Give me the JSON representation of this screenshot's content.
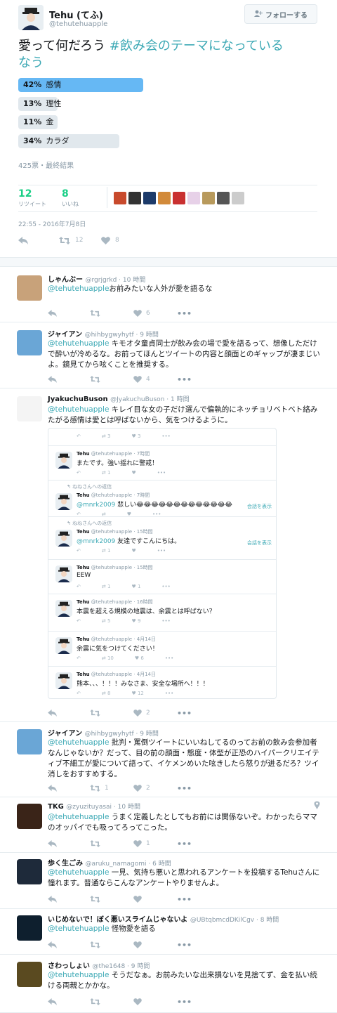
{
  "header": {
    "name": "Tehu (てふ)",
    "handle": "@tehutehuapple",
    "follow_label": "フォローする"
  },
  "poll": {
    "question": "愛って何だろう ",
    "hashtag": "#飲み会のテーマになっているなう",
    "hashtag_line1": "#飲み会のテーマになっている",
    "hashtag_line2": "なう",
    "options": [
      {
        "pct": "42%",
        "label": "感情",
        "value": 42
      },
      {
        "pct": "13%",
        "label": "理性",
        "value": 13
      },
      {
        "pct": "11%",
        "label": "金",
        "value": 11
      },
      {
        "pct": "34%",
        "label": "カラダ",
        "value": 34
      }
    ],
    "summary": "425票・最終結果"
  },
  "stats": {
    "retweets": "12",
    "retweets_label": "リツイート",
    "likes": "8",
    "likes_label": "いいね"
  },
  "timestamp": "22:55 - 2016年7月8日",
  "main_actions": {
    "retweets": "12",
    "likes": "8"
  },
  "replies": [
    {
      "name": "しゃんぶー",
      "handle": "@rgrjgrkd",
      "time": "10 時間",
      "mention": "@tehutehuapple",
      "text": "お前みたいな人外が愛を語るな",
      "rt": "",
      "like": "6"
    },
    {
      "name": "ジャイアン",
      "handle": "@hihbygwyhytf",
      "time": "9 時間",
      "mention": "@tehutehuapple",
      "text": " キモオタ童貞同士が飲み会の場で愛を語るって、想像しただけで酔いが冷めるな。お前ってほんとツイートの内容と顔面とのギャップが凄まじいよ。鏡見てから呟くことを推奨する。",
      "rt": "",
      "like": "4"
    },
    {
      "name": "JyakuchuBuson",
      "handle": "@JyakuchuBuson",
      "time": "1 時間",
      "mention": "@tehutehuapple",
      "text": " キレイ目な女の子だけ選んで偏執的にネッチョリベトベト絡みたがる感情は愛とは呼ばないから、気をつけるように。",
      "rt": "",
      "like": "2"
    },
    {
      "name": "ジャイアン",
      "handle": "@hihbygwyhytf",
      "time": "9 時間",
      "mention": "@tehutehuapple",
      "text": " 批判・罵倒ツイートにいいねしてるのってお前の飲み会参加者なんじゃないか？だって、目の前の顔面・態度・体型が正恐のハイパークリエイティブ不細工が愛について語って、イケメンめいた呟きしたら怒りが迸るだろ？ツイ消しをおすすめする。",
      "rt": "1",
      "like": "2"
    },
    {
      "name": "TKG",
      "handle": "@zyuzituyasai",
      "time": "10 時間",
      "mention": "@tehutehuapple",
      "text": " うまく定義したとしてもお前には関係ないぞ。わかったらママのオッパイでも吸ってろってこった。",
      "rt": "",
      "like": "1"
    },
    {
      "name": "歩く生ごみ",
      "handle": "@aruku_namagomi",
      "time": "6 時間",
      "mention": "@tehutehuapple",
      "text": " 一見、気持ち悪いと思われるアンケートを投稿するTehuさんに憧れます。普通ならこんなアンケートやりませんよ。",
      "rt": "",
      "like": ""
    },
    {
      "name": "いじめないで！ぼく悪いスライムじゃないよ",
      "handle": "@UBtqbmcdDKilCgv",
      "time": "8 時間",
      "mention": "@tehutehuapple",
      "text": " 怪物愛を語る",
      "rt": "",
      "like": ""
    },
    {
      "name": "さわっしょい",
      "handle": "@the1648",
      "time": "9 時間",
      "mention": "@tehutehuapple",
      "text": " そうだなぁ。お前みたいな出来損ないを見捨てず、金を払い続ける両親とかかな。",
      "rt": "",
      "like": ""
    }
  ],
  "embedded": {
    "top_acts": {
      "rt": "3",
      "like": "3"
    },
    "items": [
      {
        "name": "Tehu",
        "handle": "@tehutehuapple",
        "time": "7時間",
        "text": "またです。強い揺れに警戒！",
        "rt": "1",
        "like": ""
      },
      {
        "replying": "ねねさんへの返信",
        "name": "Tehu",
        "handle": "@tehutehuapple",
        "time": "7時間",
        "mention": "@mnrk2009",
        "text": " 悲しい😂😂😂😂😂😂😂😂😂😂😂😂😂",
        "convo": "会話を表示"
      },
      {
        "replying": "ねねさんへの返信",
        "name": "Tehu",
        "handle": "@tehutehuapple",
        "time": "15時間",
        "mention": "@mnrk2009",
        "text": " 友達ですこんにちは。",
        "rt": "1",
        "convo": "会話を表示"
      },
      {
        "name": "Tehu",
        "handle": "@tehutehuapple",
        "time": "15時間",
        "text": "EEW",
        "rt": "1",
        "like": "1"
      },
      {
        "name": "Tehu",
        "handle": "@tehutehuapple",
        "time": "16時間",
        "text": "本震を超える規模の地震は、余震とは呼ばない？",
        "rt": "5",
        "like": "9"
      },
      {
        "name": "Tehu",
        "handle": "@tehutehuapple",
        "time": "4月14日",
        "text": "余震に気をつけてください！",
        "rt": "10",
        "like": "6"
      },
      {
        "name": "Tehu",
        "handle": "@tehutehuapple",
        "time": "4月14日",
        "text": "熊本、、、！！！みなさま、安全な場所へ！！！",
        "rt": "8",
        "like": "12"
      }
    ]
  },
  "colors": {
    "accent": "#3da9b5",
    "poll_winner": "#66b8f4",
    "poll_bar": "#e1e8ed",
    "stat": "#19cf86"
  },
  "icons": [
    "add-user-icon",
    "reply-icon",
    "retweet-icon",
    "heart-icon",
    "more-icon",
    "location-icon"
  ]
}
